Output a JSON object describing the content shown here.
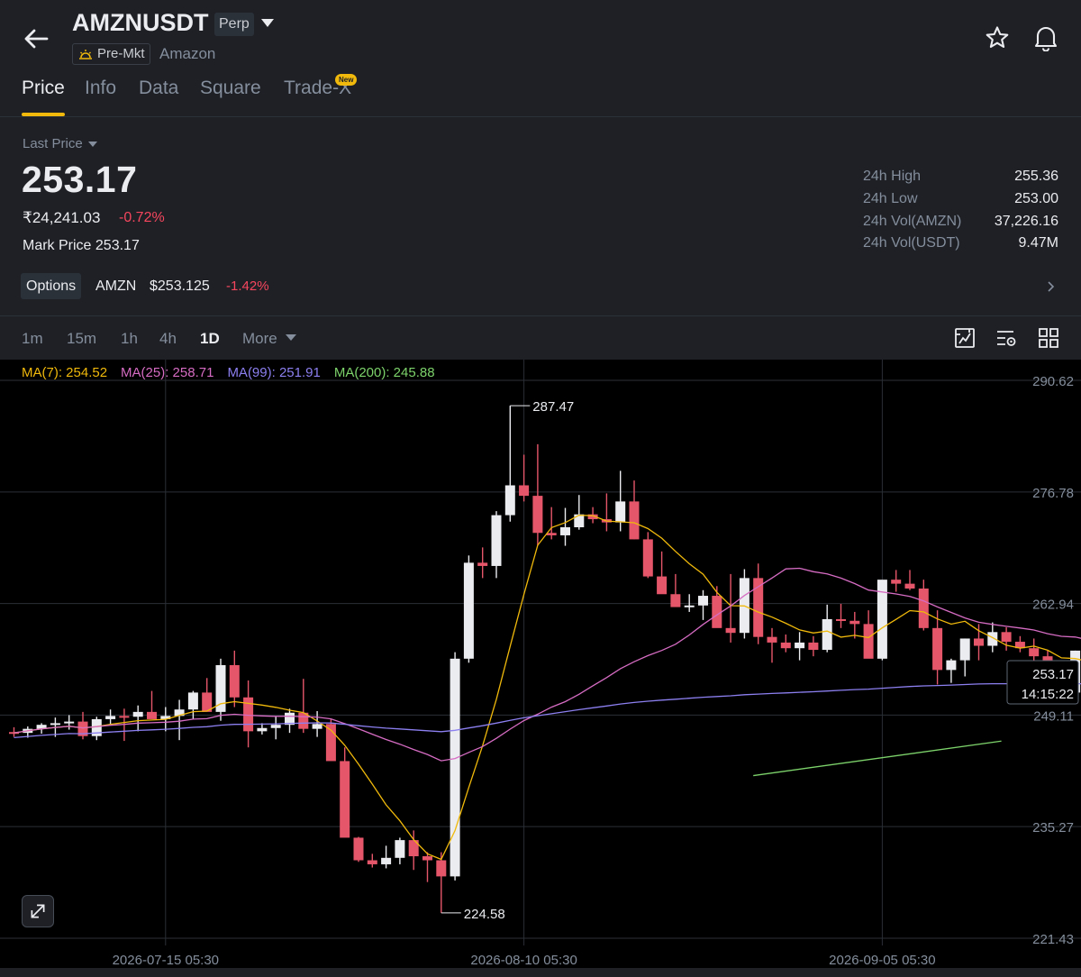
{
  "header": {
    "symbol": "AMZNUSDT",
    "contract_type": "Perp",
    "session_badge": "Pre-Mkt",
    "company": "Amazon"
  },
  "tabs": [
    {
      "label": "Price",
      "active": true
    },
    {
      "label": "Info"
    },
    {
      "label": "Data"
    },
    {
      "label": "Square"
    },
    {
      "label": "Trade-X",
      "badge": "New"
    }
  ],
  "price": {
    "label": "Last Price",
    "last": "253.17",
    "inr": "₹24,241.03",
    "change": "-0.72%",
    "mark_label": "Mark Price",
    "mark": "253.17"
  },
  "stats": [
    {
      "label": "24h High",
      "value": "255.36"
    },
    {
      "label": "24h Low",
      "value": "253.00"
    },
    {
      "label": "24h Vol(AMZN)",
      "value": "37,226.16"
    },
    {
      "label": "24h Vol(USDT)",
      "value": "9.47M"
    }
  ],
  "options": {
    "button": "Options",
    "symbol": "AMZN",
    "price": "$253.125",
    "change": "-1.42%"
  },
  "intervals": [
    "1m",
    "15m",
    "1h",
    "4h",
    "1D"
  ],
  "active_interval": "1D",
  "more_label": "More",
  "ma": [
    {
      "label": "MA(7): 254.52",
      "color": "#f0b90b"
    },
    {
      "label": "MA(25): 258.71",
      "color": "#d66cc3"
    },
    {
      "label": "MA(99): 251.91",
      "color": "#8c7ff0"
    },
    {
      "label": "MA(200): 245.88",
      "color": "#7dd36b"
    }
  ],
  "colors": {
    "up": "#eaecef",
    "down": "#e6566a",
    "accent": "#f0b90b"
  },
  "chart_data": {
    "type": "candlestick",
    "y_ticks": [
      "290.62",
      "276.78",
      "262.94",
      "249.11",
      "235.27",
      "221.43"
    ],
    "x_ticks": [
      "2026-07-15 05:30",
      "2026-08-10 05:30",
      "2026-09-05 05:30"
    ],
    "ylim": [
      221.43,
      290.62
    ],
    "high_marker": "287.47",
    "low_marker": "224.58",
    "current_price": "253.17",
    "countdown": "14:15:22",
    "candles": [
      [
        247.0,
        247.6,
        246.4,
        246.9
      ],
      [
        246.9,
        247.7,
        246.3,
        247.4
      ],
      [
        247.4,
        248.1,
        246.8,
        247.9
      ],
      [
        247.9,
        248.8,
        246.4,
        248.1
      ],
      [
        248.1,
        249.1,
        247.3,
        248.3
      ],
      [
        248.3,
        249.5,
        246.1,
        246.5
      ],
      [
        246.5,
        248.9,
        246.0,
        248.6
      ],
      [
        248.6,
        249.8,
        247.9,
        249.0
      ],
      [
        249.0,
        249.9,
        245.9,
        248.9
      ],
      [
        248.9,
        250.3,
        247.1,
        249.5
      ],
      [
        249.5,
        252.1,
        248.8,
        248.6
      ],
      [
        248.6,
        250.1,
        247.1,
        249.0
      ],
      [
        249.0,
        251.0,
        246.0,
        249.8
      ],
      [
        249.8,
        252.1,
        248.6,
        251.9
      ],
      [
        251.9,
        253.7,
        249.9,
        249.5
      ],
      [
        249.5,
        256.1,
        248.4,
        255.3
      ],
      [
        255.3,
        257.1,
        250.1,
        251.3
      ],
      [
        251.3,
        253.4,
        245.1,
        247.1
      ],
      [
        247.1,
        248.1,
        246.7,
        247.5
      ],
      [
        247.5,
        248.9,
        246.1,
        247.9
      ],
      [
        247.9,
        249.9,
        246.9,
        249.4
      ],
      [
        249.4,
        253.6,
        246.9,
        247.4
      ],
      [
        247.4,
        249.6,
        246.4,
        248.0
      ],
      [
        248.0,
        248.6,
        244.1,
        243.4
      ],
      [
        243.4,
        245.1,
        235.9,
        233.9
      ],
      [
        233.9,
        234.0,
        230.9,
        231.1
      ],
      [
        231.1,
        231.9,
        230.2,
        230.6
      ],
      [
        230.6,
        232.9,
        230.1,
        231.4
      ],
      [
        231.4,
        233.9,
        230.6,
        233.6
      ],
      [
        233.6,
        234.8,
        229.9,
        231.6
      ],
      [
        231.6,
        232.1,
        228.4,
        231.1
      ],
      [
        231.1,
        232.1,
        224.58,
        229.1
      ],
      [
        229.1,
        256.9,
        228.6,
        256.1
      ],
      [
        256.1,
        268.9,
        255.6,
        268.0
      ],
      [
        268.0,
        269.9,
        266.1,
        267.6
      ],
      [
        267.6,
        274.4,
        266.1,
        273.9
      ],
      [
        273.9,
        287.47,
        273.1,
        277.6
      ],
      [
        277.6,
        281.4,
        275.6,
        276.3
      ],
      [
        276.3,
        282.7,
        270.1,
        271.7
      ],
      [
        271.7,
        274.9,
        270.9,
        271.4
      ],
      [
        271.4,
        274.8,
        270.1,
        272.4
      ],
      [
        272.4,
        276.4,
        272.1,
        274.0
      ],
      [
        274.0,
        274.9,
        272.9,
        273.4
      ],
      [
        273.4,
        276.6,
        271.9,
        273.0
      ],
      [
        273.0,
        279.4,
        271.9,
        275.6
      ],
      [
        275.6,
        278.2,
        270.9,
        270.9
      ],
      [
        270.9,
        271.8,
        266.1,
        266.3
      ],
      [
        266.3,
        269.4,
        264.6,
        264.1
      ],
      [
        264.1,
        266.6,
        262.6,
        262.5
      ],
      [
        262.5,
        264.1,
        261.9,
        262.7
      ],
      [
        262.7,
        264.6,
        260.9,
        263.9
      ],
      [
        263.9,
        265.1,
        260.1,
        259.9
      ],
      [
        259.9,
        266.6,
        258.1,
        259.3
      ],
      [
        259.3,
        267.2,
        258.6,
        266.1
      ],
      [
        266.1,
        267.9,
        257.9,
        258.8
      ],
      [
        258.8,
        259.9,
        255.6,
        258.1
      ],
      [
        258.1,
        259.1,
        256.9,
        257.4
      ],
      [
        257.4,
        259.4,
        255.9,
        258.1
      ],
      [
        258.1,
        258.9,
        256.4,
        257.2
      ],
      [
        257.2,
        262.8,
        256.9,
        261.0
      ],
      [
        261.0,
        262.9,
        259.9,
        260.8
      ],
      [
        260.8,
        261.9,
        258.6,
        260.4
      ],
      [
        260.4,
        262.1,
        256.6,
        256.1
      ],
      [
        256.1,
        264.9,
        255.9,
        265.9
      ],
      [
        265.9,
        267.1,
        264.4,
        265.4
      ],
      [
        265.4,
        267.1,
        264.6,
        264.8
      ],
      [
        264.8,
        265.9,
        259.6,
        259.9
      ],
      [
        259.9,
        262.1,
        252.9,
        254.7
      ],
      [
        254.7,
        256.1,
        253.1,
        255.9
      ],
      [
        255.9,
        258.6,
        253.9,
        258.6
      ],
      [
        258.6,
        260.4,
        255.9,
        257.7
      ],
      [
        257.7,
        260.6,
        256.9,
        259.4
      ],
      [
        259.4,
        260.0,
        257.1,
        258.2
      ],
      [
        258.2,
        258.9,
        256.9,
        257.4
      ],
      [
        257.4,
        258.6,
        254.9,
        256.4
      ],
      [
        256.4,
        257.1,
        251.4,
        252.4
      ],
      [
        252.4,
        253.6,
        251.4,
        251.9
      ],
      [
        251.9,
        257.1,
        251.6,
        257.1
      ],
      [
        257.1,
        257.4,
        255.6,
        256.9
      ],
      [
        256.9,
        257.4,
        253.9,
        253.9
      ],
      [
        253.9,
        255.6,
        252.6,
        253.17
      ]
    ]
  }
}
